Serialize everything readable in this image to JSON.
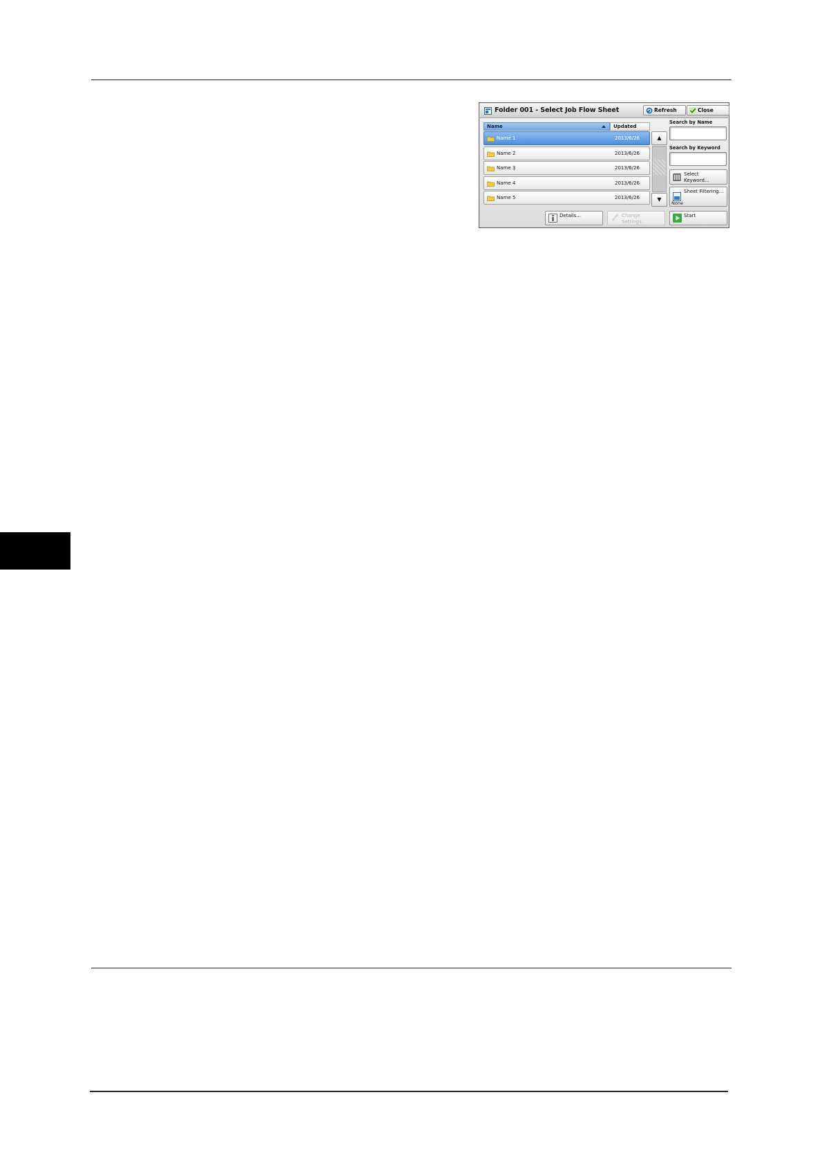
{
  "colors": {
    "selection": "#5f9be0",
    "start_green": "#3daa3d",
    "folder_yellow": "#f3c94a"
  },
  "panel": {
    "title": "Folder 001 - Select Job Flow Sheet",
    "refresh_label": "Refresh",
    "close_label": "Close",
    "columns": {
      "name": "Name",
      "updated": "Updated"
    },
    "rows": [
      {
        "name": "Name 1",
        "date": "2013/6/26",
        "selected": true
      },
      {
        "name": "Name 2",
        "date": "2013/6/26",
        "selected": false
      },
      {
        "name": "Name 3",
        "date": "2013/6/26",
        "selected": false
      },
      {
        "name": "Name 4",
        "date": "2013/6/26",
        "selected": false
      },
      {
        "name": "Name 5",
        "date": "2013/6/26",
        "selected": false
      }
    ],
    "search_by_name_label": "Search by Name",
    "search_by_name_value": "",
    "search_by_keyword_label": "Search by Keyword",
    "search_by_keyword_value": "",
    "select_keyword_line1": "Select",
    "select_keyword_line2": "Keyword...",
    "sheet_filtering_label": "Sheet Filtering...",
    "sheet_filtering_value": "None",
    "details_label": "Details...",
    "change_settings_line1": "Change",
    "change_settings_line2": "Settings...",
    "start_label": "Start"
  }
}
